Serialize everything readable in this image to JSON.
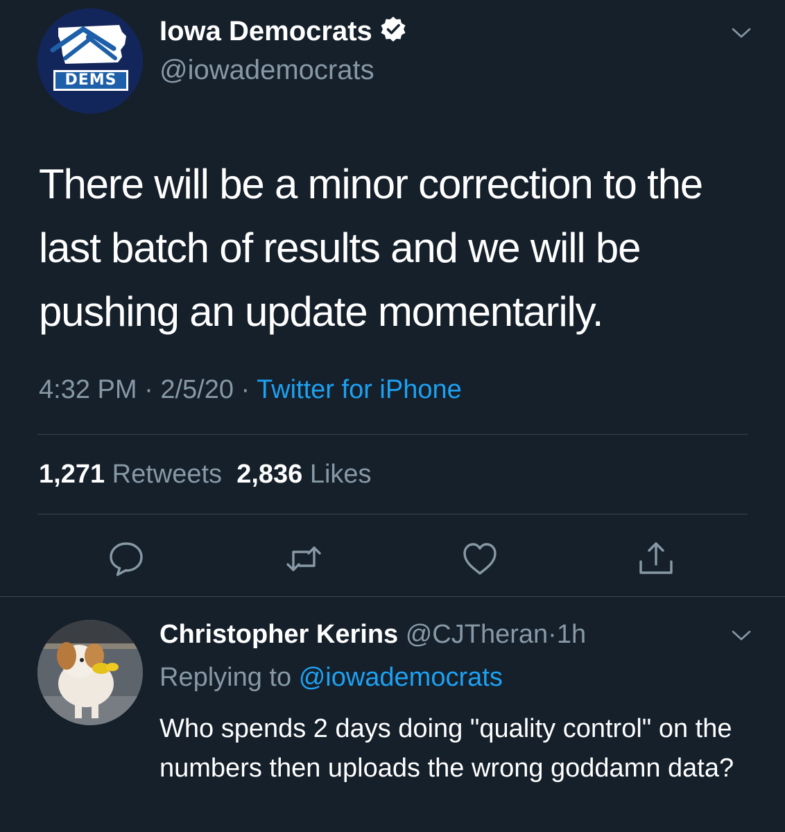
{
  "tweet": {
    "author": {
      "display_name": "Iowa Democrats",
      "handle": "@iowademocrats",
      "verified": true,
      "avatar_badge": "DEMS"
    },
    "text": "There will be a minor correction to the last batch of results and we will be pushing an update momentarily.",
    "time": "4:32 PM",
    "date": "2/5/20",
    "source": "Twitter for iPhone",
    "separator": "·",
    "retweets_count": "1,271",
    "retweets_label": "Retweets",
    "likes_count": "2,836",
    "likes_label": "Likes",
    "actions": [
      "reply-icon",
      "retweet-icon",
      "like-icon",
      "share-icon"
    ]
  },
  "reply": {
    "display_name": "Christopher Kerins",
    "handle": "@CJTheran",
    "separator": "·",
    "age": "1h",
    "replying_prefix": "Replying to",
    "replying_to": "@iowademocrats",
    "text": "Who spends 2 days doing \"quality control\" on the numbers then uploads the wrong goddamn data?"
  },
  "colors": {
    "background": "#15202b",
    "text": "#ffffff",
    "secondary_text": "#8899a6",
    "link": "#1da1f2",
    "divider": "#38444d"
  }
}
